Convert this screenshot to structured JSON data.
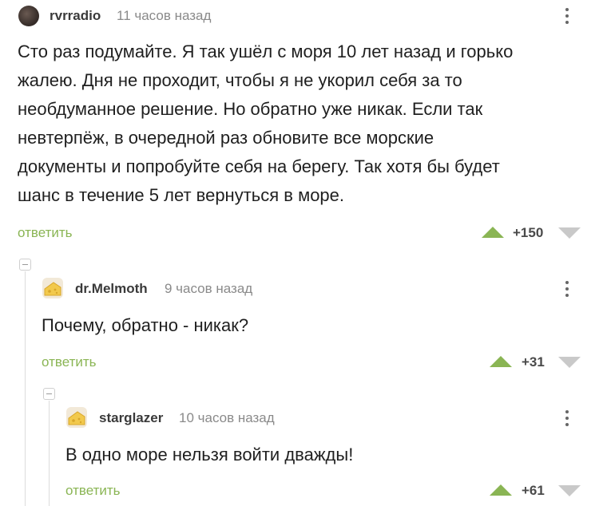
{
  "comments": [
    {
      "username": "rvrradio",
      "time": "11 часов назад",
      "text": "Сто раз подумайте. Я так ушёл с моря 10 лет назад и горько жалею. Дня не проходит, чтобы я не укорил себя за то необдуманное решение. Но обратно уже никак. Если так невтерпёж, в очередной раз обновите все морские документы и попробуйте себя на берегу. Так хотя бы будет шанс в течение 5 лет вернуться в море.",
      "lines": [
        "Сто раз подумайте. Я так ушёл с моря 10 лет назад и горько",
        "жалею. Дня не проходит, чтобы я не укорил себя за то",
        "необдуманное решение. Но обратно уже никак. Если так",
        "невтерпёж, в очередной раз обновите все морские",
        "документы и попробуйте себя на берегу. Так хотя бы будет",
        "шанс в течение 5 лет вернуться в море."
      ],
      "reply_label": "ответить",
      "score": "+150"
    },
    {
      "username": "dr.Melmoth",
      "time": "9 часов назад",
      "text": "Почему, обратно - никак?",
      "reply_label": "ответить",
      "score": "+31"
    },
    {
      "username": "starglazer",
      "time": "10 часов назад",
      "text": "В одно море нельзя войти дважды!",
      "reply_label": "ответить",
      "score": "+61"
    }
  ],
  "colors": {
    "accent_green": "#8ab554",
    "downvote_gray": "#c9c9c9",
    "text": "#1f1f1f",
    "muted": "#8a8a8a"
  },
  "icons": {
    "menu": "vertical-dots-icon",
    "upvote": "triangle-up-icon",
    "downvote": "triangle-down-icon",
    "collapse": "minus-box-icon"
  }
}
